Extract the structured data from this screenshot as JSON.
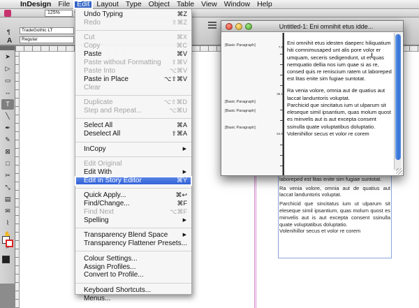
{
  "menubar": {
    "apple_glyph": "",
    "items": [
      "InDesign",
      "File",
      "Edit",
      "Layout",
      "Type",
      "Object",
      "Table",
      "View",
      "Window",
      "Help"
    ]
  },
  "toolbar": {
    "zoom": "125%"
  },
  "control_panel": {
    "font_family": "TradeGothic LT",
    "font_style": "Regular",
    "char_icon": "A",
    "para_icon": "¶"
  },
  "edit_menu": {
    "items": [
      {
        "label": "Undo Typing",
        "shortcut": "⌘Z",
        "enabled": true
      },
      {
        "label": "Redo",
        "shortcut": "⇧⌘Z",
        "enabled": false
      },
      {
        "separator": true
      },
      {
        "label": "Cut",
        "shortcut": "⌘X",
        "enabled": false
      },
      {
        "label": "Copy",
        "shortcut": "⌘C",
        "enabled": false
      },
      {
        "label": "Paste",
        "shortcut": "⌘V",
        "enabled": true
      },
      {
        "label": "Paste without Formatting",
        "shortcut": "⇧⌘V",
        "enabled": false
      },
      {
        "label": "Paste Into",
        "shortcut": "⌥⌘V",
        "enabled": false
      },
      {
        "label": "Paste in Place",
        "shortcut": "⌥⇧⌘V",
        "enabled": true
      },
      {
        "label": "Clear",
        "shortcut": "",
        "enabled": false
      },
      {
        "separator": true
      },
      {
        "label": "Duplicate",
        "shortcut": "⌥⇧⌘D",
        "enabled": false
      },
      {
        "label": "Step and Repeat...",
        "shortcut": "⌥⌘U",
        "enabled": false
      },
      {
        "separator": true
      },
      {
        "label": "Select All",
        "shortcut": "⌘A",
        "enabled": true
      },
      {
        "label": "Deselect All",
        "shortcut": "⇧⌘A",
        "enabled": true
      },
      {
        "separator": true
      },
      {
        "label": "InCopy",
        "submenu": true,
        "enabled": true
      },
      {
        "separator": true
      },
      {
        "label": "Edit Original",
        "shortcut": "",
        "enabled": false
      },
      {
        "label": "Edit With",
        "submenu": true,
        "enabled": true
      },
      {
        "label": "Edit in Story Editor",
        "shortcut": "⌘Y",
        "enabled": true,
        "highlighted": true
      },
      {
        "separator": true
      },
      {
        "label": "Quick Apply...",
        "shortcut": "⌘↩",
        "enabled": true
      },
      {
        "label": "Find/Change...",
        "shortcut": "⌘F",
        "enabled": true
      },
      {
        "label": "Find Next",
        "shortcut": "⌥⌘F",
        "enabled": false
      },
      {
        "label": "Spelling",
        "submenu": true,
        "enabled": true
      },
      {
        "separator": true
      },
      {
        "label": "Transparency Blend Space",
        "submenu": true,
        "enabled": true
      },
      {
        "label": "Transparency Flattener Presets...",
        "shortcut": "",
        "enabled": true
      },
      {
        "separator": true
      },
      {
        "label": "Colour Settings...",
        "shortcut": "",
        "enabled": true
      },
      {
        "label": "Assign Profiles...",
        "shortcut": "",
        "enabled": true
      },
      {
        "label": "Convert to Profile...",
        "shortcut": "",
        "enabled": true
      },
      {
        "separator": true
      },
      {
        "label": "Keyboard Shortcuts...",
        "shortcut": "",
        "enabled": true
      },
      {
        "label": "Menus...",
        "shortcut": "",
        "enabled": true
      }
    ]
  },
  "story_editor": {
    "title": "Untitled-1: Eni omnihit etus idde...",
    "paragraph_styles": [
      "[Basic Paragraph]",
      "[Basic Paragraph]",
      "[Basic Paragraph]",
      "[Basic Paragraph]"
    ],
    "depths": [
      "7.5",
      "36.1",
      "54.6"
    ],
    "paragraphs": [
      "Eni omnihit etus idesten daeperc hiliquatium hiti comnimusaped unt alis pore volor er umquam, seceris sedigendunt, ut et quas nemquatio dellia nos ium quae si as re, consed quis re reniscium ratem ut laboreped est litas enite sim fugiae suntotat.",
      "Ra venia volore, omnia aut de quatius aut laccat landuntoris voluptat.",
      "Parchicid que sincitatus ium ut ulparum sit eleseque simil ipsantium, quas molum quost es minvelis aut is aut excepta consent ssinulla quate voluptatibus doluptatio.",
      "Volenihillor secus et volor re corem"
    ]
  },
  "layout_text": {
    "paragraphs": [
      "si as re, consed quis re reniscium ratem ut laboreped est litas enite sim fugiae suntotat.",
      "Ra venia volore, omnia aut de quatius aut laccat landuntoris voluptat.",
      "Parchicid que sincitatus ium ut ulparum sit eleseque simil ipsantium, quas molum quost es minvelis aut is aut excepta consent ssinulla quate voluptatibus doluptatio.",
      "Volenihillor secus et volor re corem"
    ]
  },
  "colors": {
    "menu_highlight": "#2e5fd6",
    "margin_guide": "#d58fd0",
    "frame_edge": "#8aa4d8"
  }
}
